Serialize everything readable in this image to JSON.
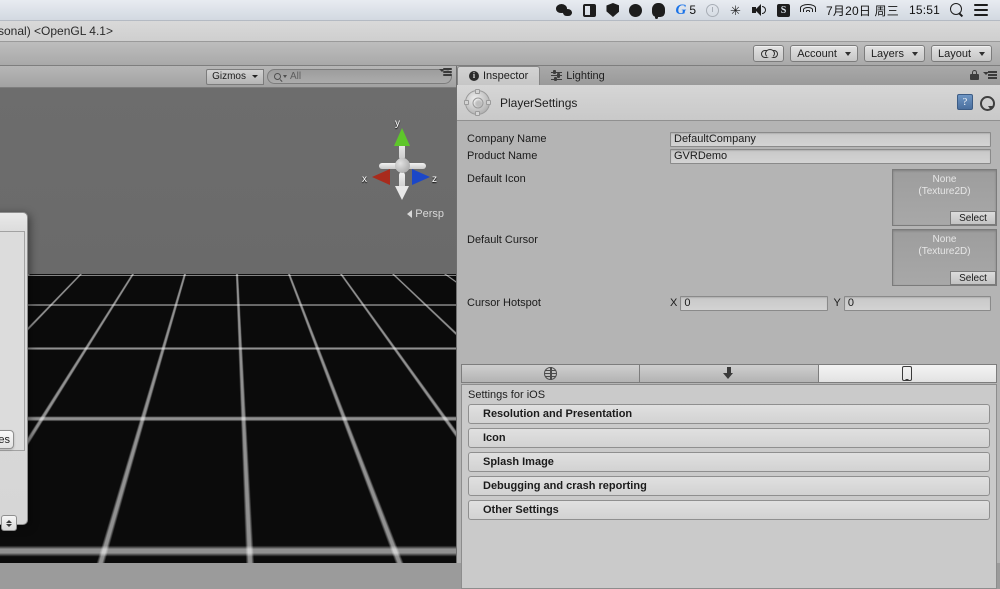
{
  "menubar": {
    "icons": [
      {
        "name": "wechat-icon",
        "label": "WeChat"
      },
      {
        "name": "split-view-icon",
        "label": "Split View"
      },
      {
        "name": "brave-shield-icon",
        "label": "Brave"
      },
      {
        "name": "dark-circle-icon",
        "label": "App"
      },
      {
        "name": "evernote-icon",
        "label": "Evernote"
      },
      {
        "name": "grammarly-g-icon",
        "label": "G"
      },
      {
        "name": "time-machine-clock-icon",
        "label": "Clock"
      },
      {
        "name": "bluetooth-icon",
        "label": "Bluetooth"
      },
      {
        "name": "volume-icon",
        "label": "Volume"
      },
      {
        "name": "snipaste-s-icon",
        "label": "S"
      },
      {
        "name": "wifi-icon",
        "label": "Wi-Fi"
      }
    ],
    "g_badge_count": "5",
    "g_letter": "G",
    "s_letter": "S",
    "date": "7月20日 周三",
    "time": "15:51",
    "search_icon": "spotlight-search-icon",
    "control_center_icon": "control-center-icon"
  },
  "window": {
    "title": "sonal) <OpenGL 4.1>"
  },
  "toolbar": {
    "cloud_label": "",
    "account_label": "Account",
    "layers_label": "Layers",
    "layout_label": "Layout"
  },
  "scene": {
    "gizmos_label": "Gizmos",
    "search_value": "All",
    "axis_x": "x",
    "axis_y": "y",
    "axis_z": "z",
    "projection_label": "Persp"
  },
  "dialog": {
    "button_label": "es"
  },
  "inspector": {
    "tabs": [
      {
        "label": "Inspector",
        "icon": "info-icon",
        "active": true
      },
      {
        "label": "Lighting",
        "icon": "lighting-sliders-icon",
        "active": false
      }
    ],
    "lock_icon": "lock-icon",
    "tab_menu_icon": "panel-menu-icon",
    "title": "PlayerSettings",
    "title_icon": "settings-cog-icon",
    "help_icon": "help-book-icon",
    "gear_icon": "gear-icon",
    "fields": {
      "company_name_label": "Company Name",
      "company_name_value": "DefaultCompany",
      "product_name_label": "Product Name",
      "product_name_value": "GVRDemo",
      "default_icon_label": "Default Icon",
      "default_icon_value": "None",
      "default_icon_type": "(Texture2D)",
      "default_icon_select": "Select",
      "default_cursor_label": "Default Cursor",
      "default_cursor_value": "None",
      "default_cursor_type": "(Texture2D)",
      "default_cursor_select": "Select",
      "cursor_hotspot_label": "Cursor Hotspot",
      "hotspot_x_label": "X",
      "hotspot_x_value": "0",
      "hotspot_y_label": "Y",
      "hotspot_y_value": "0"
    },
    "platform_tabs": [
      {
        "name": "webgl-platform-tab",
        "icon": "globe-icon",
        "active": false
      },
      {
        "name": "standalone-platform-tab",
        "icon": "download-arrow-icon",
        "active": false
      },
      {
        "name": "ios-platform-tab",
        "icon": "phone-icon",
        "active": true
      }
    ],
    "settings_header": "Settings for iOS",
    "sections": [
      "Resolution and Presentation",
      "Icon",
      "Splash Image",
      "Debugging and crash reporting",
      "Other Settings"
    ]
  },
  "colors": {
    "menubar_bg": "#dde2e9",
    "unity_chrome": "#b0b0b0",
    "inspector_bg": "#b4b4b4",
    "axis_x": "#b02a1e",
    "axis_y": "#4fbf20",
    "axis_z": "#1f4fcf",
    "accent_blue": "#1a73e8"
  }
}
